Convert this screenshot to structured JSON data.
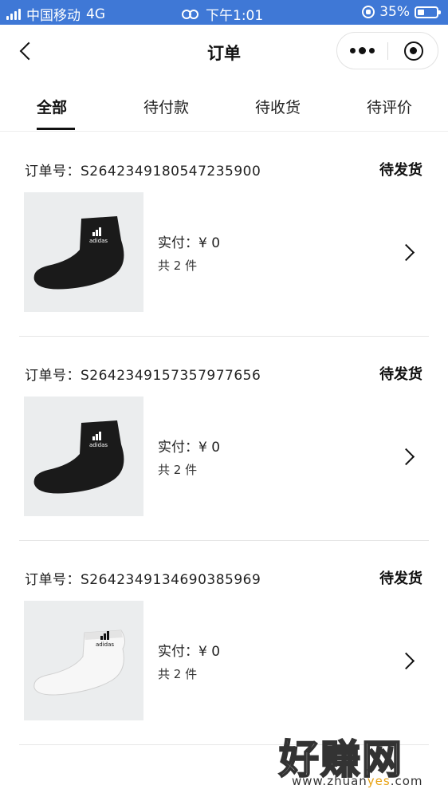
{
  "status_bar": {
    "carrier": "中国移动",
    "network": "4G",
    "time": "下午1:01",
    "battery": "35%",
    "battery_level": 0.35
  },
  "nav": {
    "title": "订单",
    "back_icon": "chevron-left-icon",
    "more_icon": "more-dots-icon",
    "close_icon": "mini-program-close-icon"
  },
  "tabs": [
    {
      "label": "全部",
      "active": true
    },
    {
      "label": "待付款",
      "active": false
    },
    {
      "label": "待收货",
      "active": false
    },
    {
      "label": "待评价",
      "active": false
    }
  ],
  "orders": [
    {
      "order_no": "订单号：S2642349180547235900",
      "status": "待发货",
      "paid": "实付：¥ 0",
      "count": "共 2 件",
      "sock_color": "#1a1a1a",
      "logo_color": "#ffffff"
    },
    {
      "order_no": "订单号：S2642349157357977656",
      "status": "待发货",
      "paid": "实付：¥ 0",
      "count": "共 2 件",
      "sock_color": "#1a1a1a",
      "logo_color": "#ffffff"
    },
    {
      "order_no": "订单号：S2642349134690385969",
      "status": "待发货",
      "paid": "实付：¥ 0",
      "count": "共 2 件",
      "sock_color": "#f7f7f7",
      "logo_color": "#111111"
    }
  ],
  "watermark": {
    "brand": "好赚网",
    "url_prefix": "www.zhuan",
    "url_highlight": "yes",
    "url_suffix": ".com"
  },
  "colors": {
    "status_bar_bg": "#3f78d6",
    "text": "#111111",
    "thumb_bg": "#ebedee"
  }
}
